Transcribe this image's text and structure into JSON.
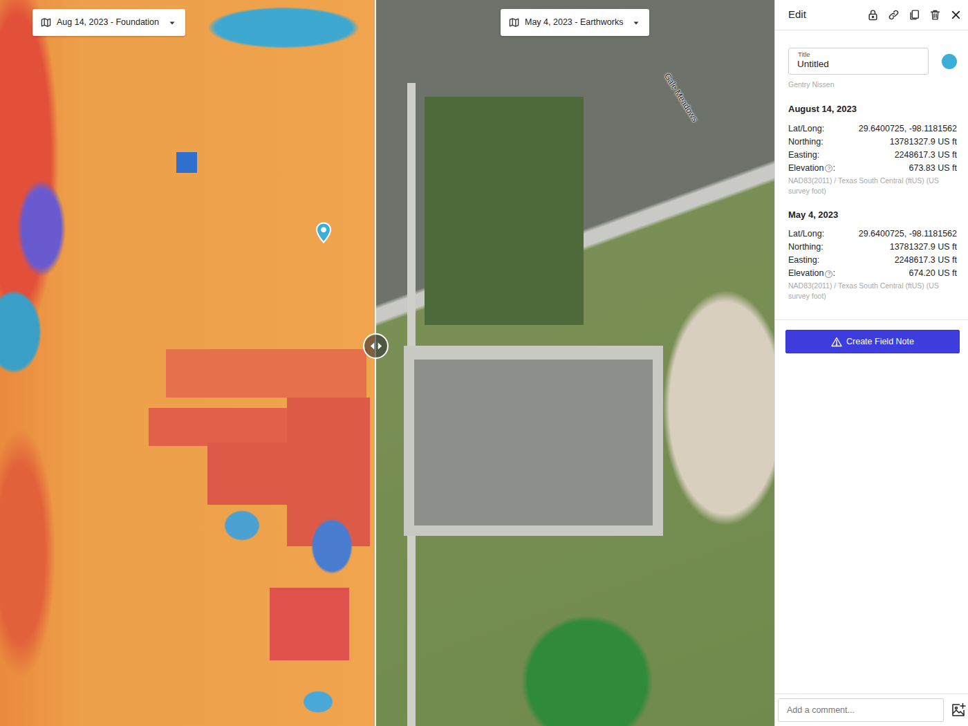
{
  "map": {
    "panes": [
      {
        "label": "Aug 14, 2023 - Foundation",
        "kind": "elevation"
      },
      {
        "label": "May 4, 2023 - Earthworks",
        "kind": "photo"
      }
    ],
    "street_label": "Gale Meadows"
  },
  "marker": {
    "color": "#3aaed8"
  },
  "panel": {
    "heading": "Edit",
    "title": {
      "label": "Title",
      "value": "Untitled"
    },
    "author": "Gentry Nissen",
    "help_icon": "?",
    "snapshots": [
      {
        "date": "August 14, 2023",
        "rows": [
          {
            "label": "Lat/Long:",
            "help": false,
            "suffix": "",
            "value": "29.6400725, -98.1181562"
          },
          {
            "label": "Northing:",
            "help": false,
            "suffix": "",
            "value": "13781327.9 US ft"
          },
          {
            "label": "Easting:",
            "help": false,
            "suffix": "",
            "value": "2248617.3 US ft"
          },
          {
            "label": "Elevation",
            "help": true,
            "suffix": ":",
            "value": "673.83 US ft"
          }
        ],
        "crs": "NAD83(2011) / Texas South Central (ftUS) (US survey foot)"
      },
      {
        "date": "May 4, 2023",
        "rows": [
          {
            "label": "Lat/Long:",
            "help": false,
            "suffix": "",
            "value": "29.6400725, -98.1181562"
          },
          {
            "label": "Northing:",
            "help": false,
            "suffix": "",
            "value": "13781327.9 US ft"
          },
          {
            "label": "Easting:",
            "help": false,
            "suffix": "",
            "value": "2248617.3 US ft"
          },
          {
            "label": "Elevation",
            "help": true,
            "suffix": ":",
            "value": "674.20 US ft"
          }
        ],
        "crs": "NAD83(2011) / Texas South Central (ftUS) (US survey foot)"
      }
    ],
    "button": "Create Field Note",
    "comment": {
      "placeholder": "Add a comment..."
    }
  }
}
